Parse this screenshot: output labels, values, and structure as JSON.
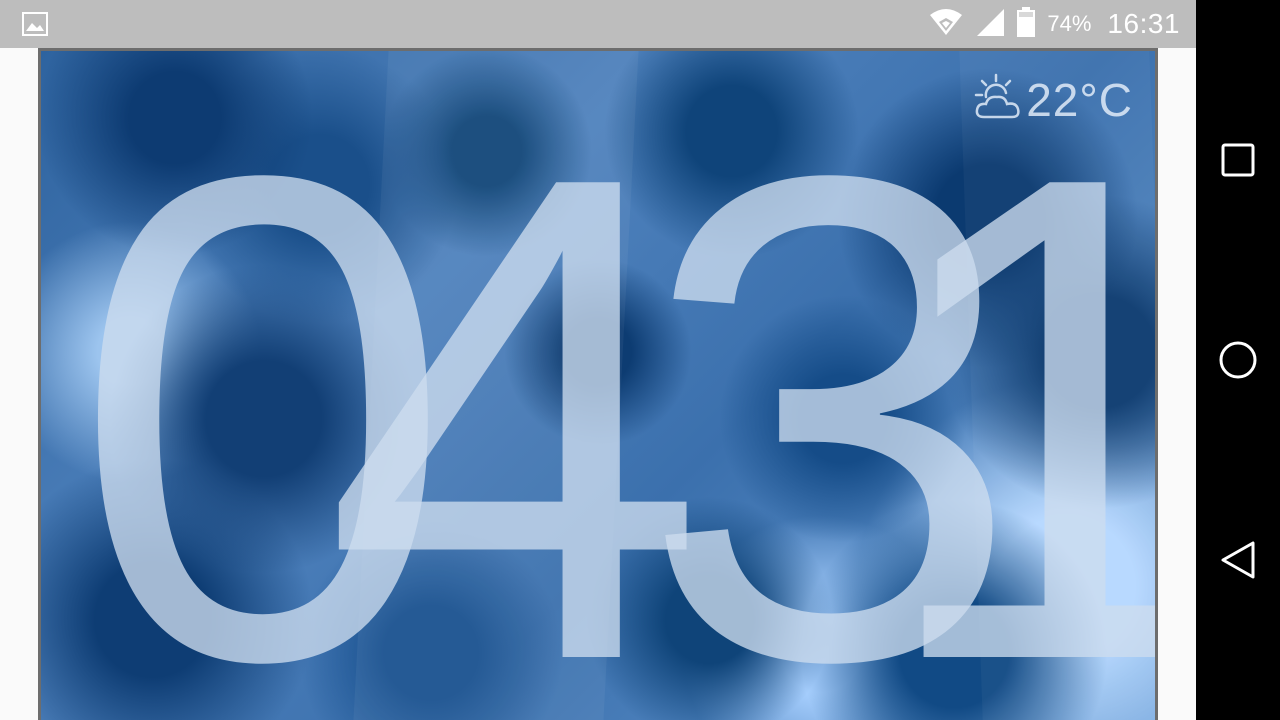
{
  "status_bar": {
    "battery_percent": "74%",
    "time": "16:31",
    "icons": [
      "gallery-notification-icon",
      "wifi-icon",
      "cell-signal-icon",
      "battery-icon"
    ]
  },
  "clock": {
    "digits": [
      "0",
      "4",
      "3",
      "1"
    ]
  },
  "weather": {
    "icon": "partly-sunny-icon",
    "temperature": "22°C"
  },
  "navigation": {
    "buttons": [
      "recents",
      "home",
      "back"
    ]
  },
  "colors": {
    "status_bar": "#bdbdbd",
    "nav_bar": "#000000",
    "panel_border": "#6d6d6d",
    "digit_color": "#cddcee"
  }
}
